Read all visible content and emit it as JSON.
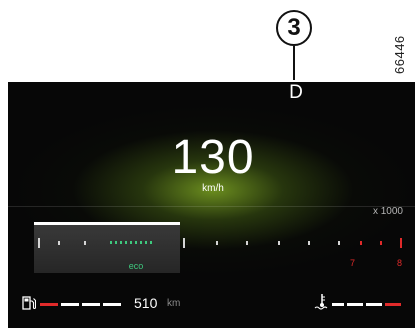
{
  "annotation": {
    "callout": "3",
    "ref_number": "66446"
  },
  "display": {
    "gear": "D",
    "speed": {
      "value": "130",
      "unit": "km/h"
    },
    "tachometer": {
      "multiplier_label": "x 1000",
      "eco_label": "eco",
      "tick_labels": [
        "7",
        "8"
      ],
      "redline_color": "#e02a2a",
      "eco_color": "#3ec97e"
    },
    "fuel": {
      "icon": "fuel-pump-icon",
      "range_value": "510",
      "range_unit": "km"
    },
    "coolant": {
      "icon": "coolant-temperature-icon"
    }
  }
}
